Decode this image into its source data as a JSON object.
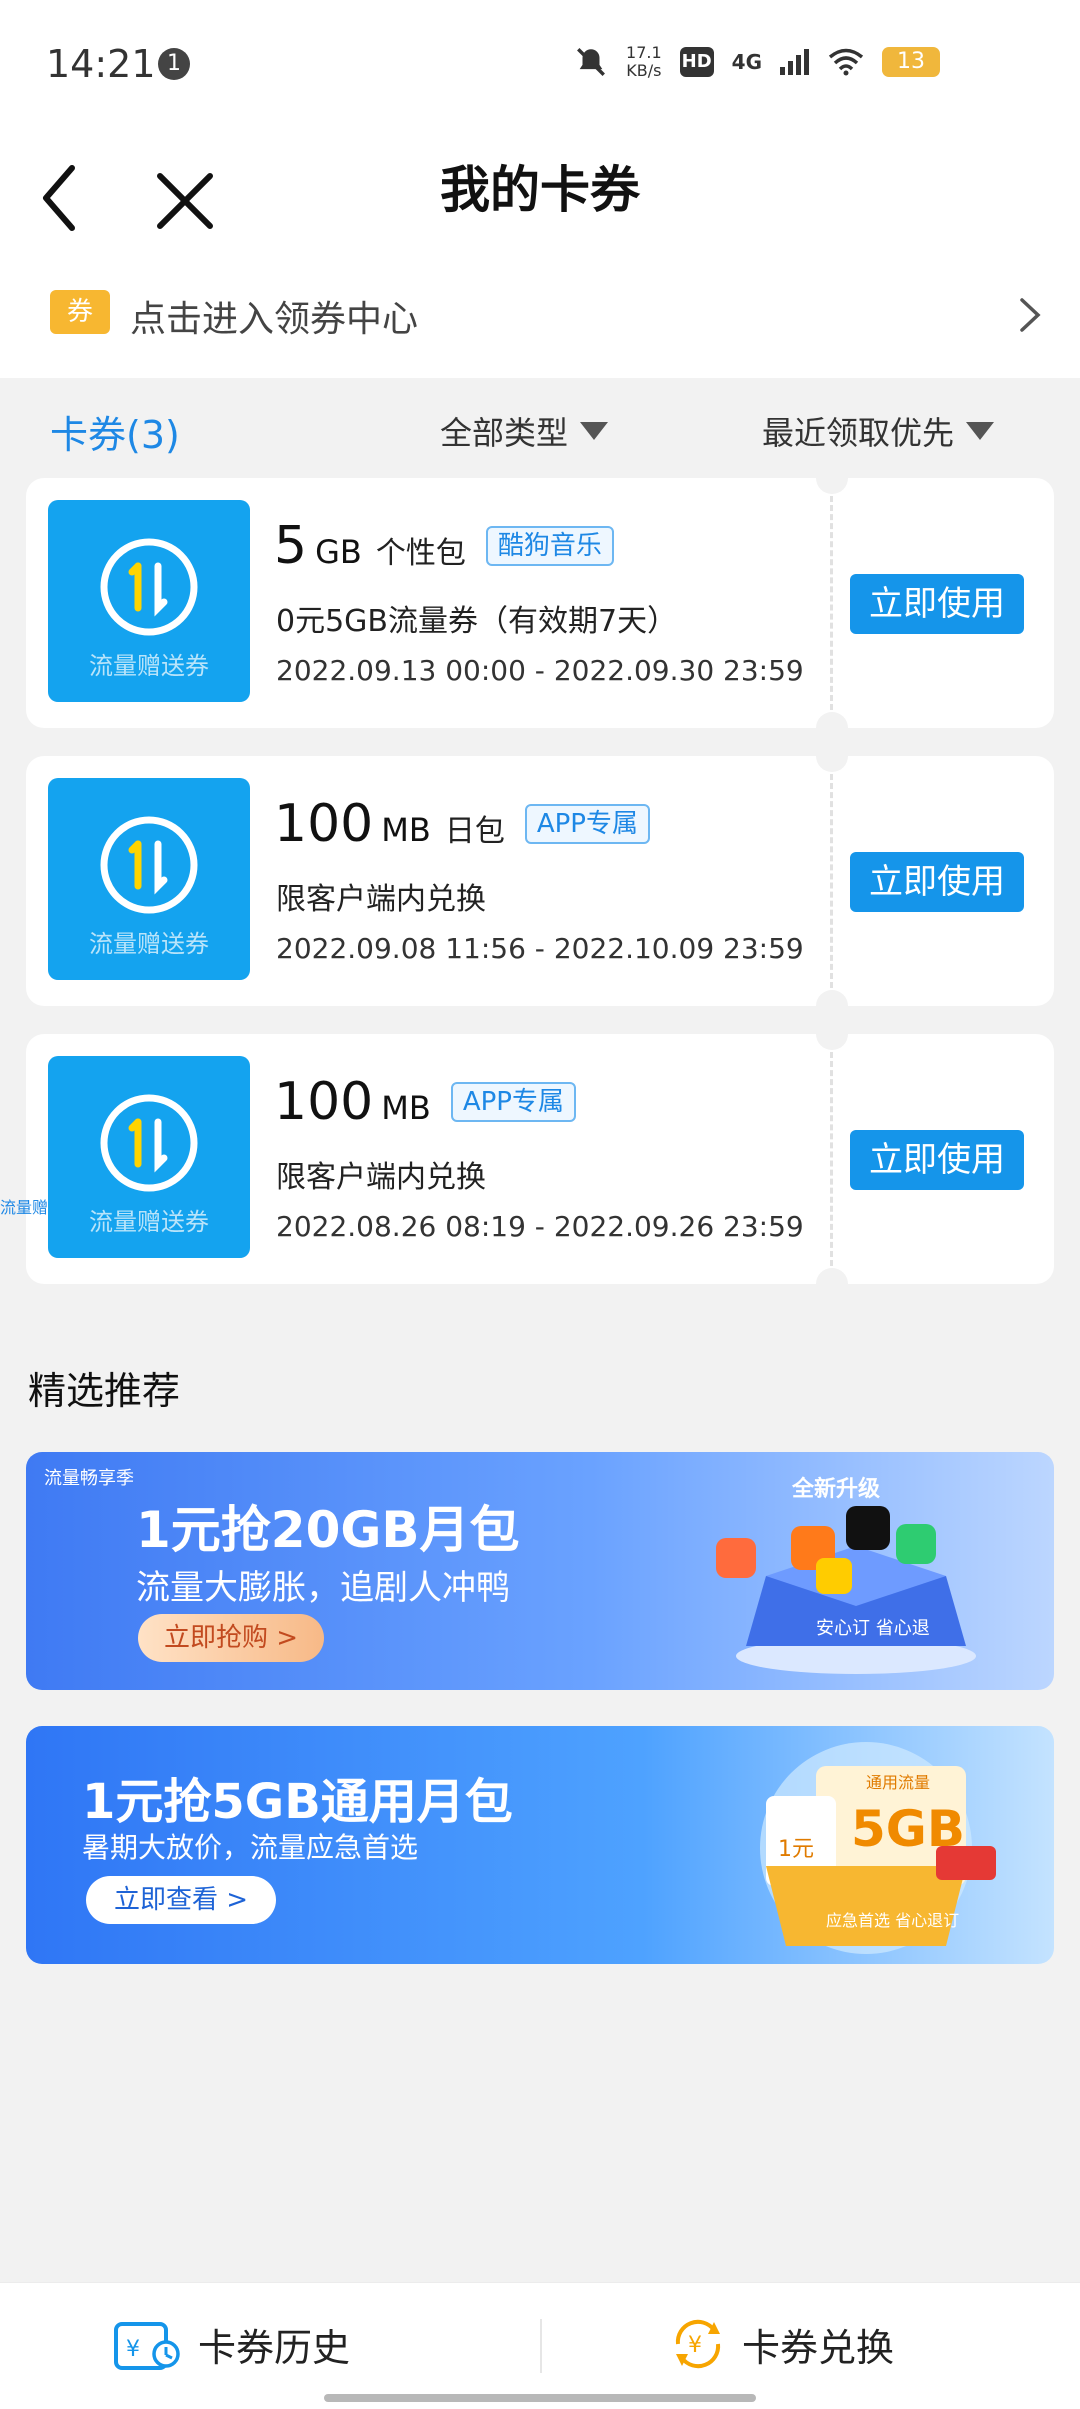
{
  "status": {
    "time": "14:21",
    "notif_count": "1",
    "speed_value": "17.1",
    "speed_unit": "KB/s",
    "hd": "HD",
    "network": "4G",
    "battery": "13"
  },
  "nav": {
    "title": "我的卡券"
  },
  "coupon_center": {
    "tag": "券",
    "text": "点击进入领券中心"
  },
  "filters": {
    "tab": "卡券(3)",
    "type": "全部类型",
    "sort": "最近领取优先"
  },
  "cards": [
    {
      "icon_label": "流量赠送券",
      "amount": "5",
      "unit": "GB",
      "package": "个性包",
      "badge": "酷狗音乐",
      "desc": "0元5GB流量券（有效期7天）",
      "date": "2022.09.13 00:00 - 2022.09.30 23:59",
      "button": "立即使用"
    },
    {
      "icon_label": "流量赠送券",
      "amount": "100",
      "unit": "MB",
      "package": "日包",
      "badge": "APP专属",
      "desc": "限客户端内兑换",
      "date": "2022.09.08 11:56 - 2022.10.09 23:59",
      "button": "立即使用"
    },
    {
      "icon_label": "流量赠送券",
      "amount": "100",
      "unit": "MB",
      "package": "",
      "badge": "APP专属",
      "desc": "限客户端内兑换",
      "date": "2022.08.26 08:19 - 2022.09.26 23:59",
      "button": "立即使用"
    }
  ],
  "side_hint": "流量赠",
  "recommend": {
    "title": "精选推荐",
    "banner1": {
      "top_label": "流量畅享季",
      "headline": "1元抢20GB月包",
      "sub": "流量大膨胀，追剧人冲鸭",
      "button": "立即抢购 >",
      "deco_text": "全新升级",
      "deco_text2": "安心订 省心退"
    },
    "banner2": {
      "headline": "1元抢5GB通用月包",
      "sub": "暑期大放价，流量应急首选",
      "button": "立即查看 >",
      "deco_tag": "通用流量",
      "deco_price": "1元",
      "deco_size": "5GB",
      "deco_label": "应急首选 省心退订"
    }
  },
  "bottom": {
    "history": "卡券历史",
    "exchange": "卡券兑换"
  },
  "colors": {
    "accent": "#1595ea",
    "tab_blue": "#1e88e5",
    "badge_yellow": "#f7b731"
  }
}
